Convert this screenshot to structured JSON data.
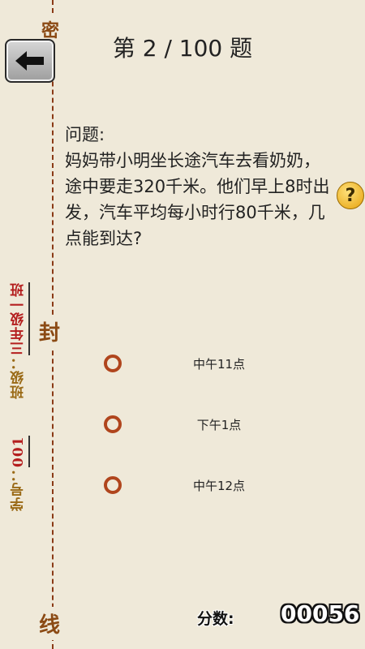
{
  "header": {
    "title": "第 2 / 100  题"
  },
  "margin": {
    "seal_top": "密",
    "seal_mid": "封",
    "seal_bottom": "线",
    "class_label": "班级：",
    "class_value": "三年级一班",
    "id_label": "学号：",
    "id_value": "001"
  },
  "question": {
    "label": "问题:",
    "text": "妈妈带小明坐长途汽车去看奶奶，途中要走320千米。他们早上8时出发，汽车平均每小时行80千米，几点能到达?"
  },
  "help_button": {
    "icon": "question-mark-icon",
    "glyph": "?"
  },
  "options": [
    {
      "label": "中午11点"
    },
    {
      "label": "下午1点"
    },
    {
      "label": "中午12点"
    }
  ],
  "score": {
    "label": "分数:",
    "value": "00056"
  },
  "colors": {
    "background": "#efe9d9",
    "radio": "#b0451d",
    "seal": "#8b4a14"
  }
}
